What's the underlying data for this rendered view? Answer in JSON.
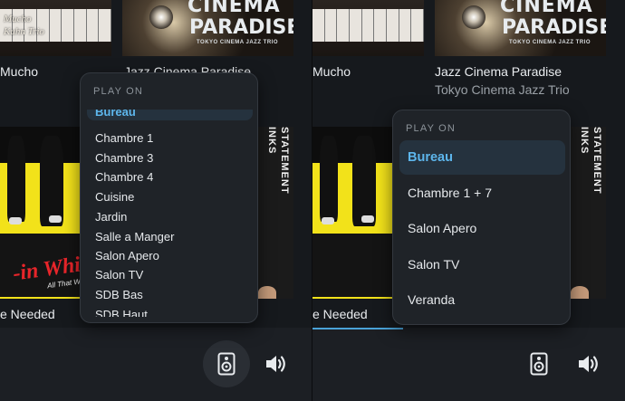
{
  "left_panel": {
    "albums": [
      {
        "title": "Mucho",
        "artist": "",
        "art_text": [
          "Mucho",
          "Kuhn Trio"
        ]
      },
      {
        "title": "Jazz Cinema Paradise",
        "artist": "",
        "art_text": [
          "CINEMA",
          "PARADISE",
          "TOKYO CINEMA JAZZ TRIO"
        ]
      },
      {
        "title": "e Needed",
        "artist": "",
        "art_text": [
          "-in White T",
          "All That We N"
        ]
      },
      {
        "title": "",
        "artist": "",
        "art_text": [
          "STATEMENT",
          "INKS"
        ]
      }
    ],
    "menu": {
      "header": "PLAY ON",
      "items": [
        "Bureau",
        "Chambre 1",
        "Chambre 3",
        "Chambre 4",
        "Cuisine",
        "Jardin",
        "Salle a Manger",
        "Salon Apero",
        "Salon TV",
        "SDB Bas",
        "SDB Haut"
      ],
      "selected": "Bureau"
    }
  },
  "right_panel": {
    "albums": [
      {
        "title": "Mucho",
        "artist": ""
      },
      {
        "title": "Jazz Cinema Paradise",
        "artist": "Tokyo Cinema Jazz Trio",
        "art_text": [
          "CINEMA",
          "PARADISE",
          "TOKYO CINEMA JAZZ TRIO"
        ]
      },
      {
        "title": "e Needed",
        "artist": ""
      },
      {
        "title": "",
        "artist": "",
        "art_text": [
          "STATEMENT",
          "INKS"
        ]
      }
    ],
    "menu": {
      "header": "PLAY ON",
      "items": [
        "Bureau",
        "Chambre 1 + 7",
        "Salon Apero",
        "Salon TV",
        "Veranda"
      ],
      "selected": "Bureau"
    }
  },
  "controls": {
    "speaker_icon": "speaker-icon",
    "volume_icon": "volume-icon"
  },
  "colors": {
    "background": "#16191d",
    "menu_background": "#1f2328",
    "selected_background": "#25323e",
    "accent": "#5db6ec",
    "text_primary": "#e9ecef",
    "text_secondary": "#9aa0a6"
  }
}
